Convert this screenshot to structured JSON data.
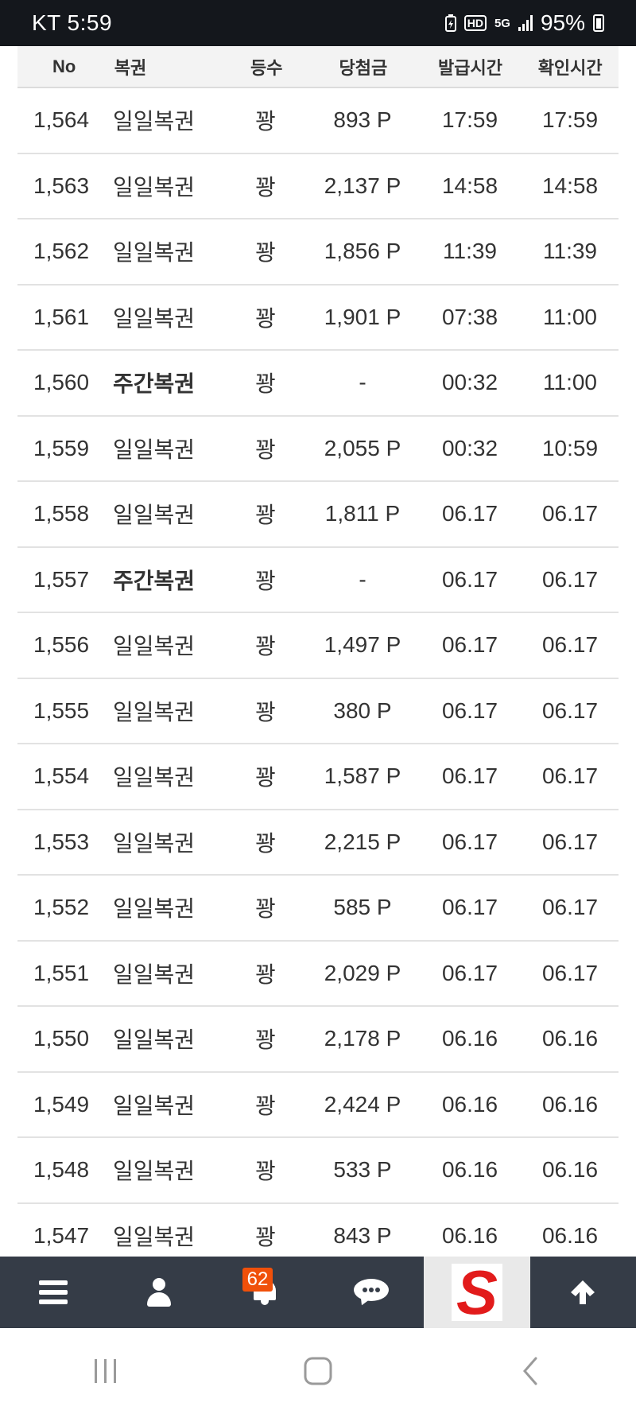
{
  "status_bar": {
    "carrier_time": "KT 5:59",
    "hd_label": "HD",
    "network_label": "5G",
    "battery": "95%"
  },
  "table": {
    "headers": {
      "no": "No",
      "type": "복권",
      "rank": "등수",
      "prize": "당첨금",
      "issued": "발급시간",
      "checked": "확인시간"
    },
    "rows": [
      {
        "no": "1,564",
        "type": "일일복권",
        "rank": "꽝",
        "prize": "893 P",
        "issued": "17:59",
        "checked": "17:59"
      },
      {
        "no": "1,563",
        "type": "일일복권",
        "rank": "꽝",
        "prize": "2,137 P",
        "issued": "14:58",
        "checked": "14:58"
      },
      {
        "no": "1,562",
        "type": "일일복권",
        "rank": "꽝",
        "prize": "1,856 P",
        "issued": "11:39",
        "checked": "11:39"
      },
      {
        "no": "1,561",
        "type": "일일복권",
        "rank": "꽝",
        "prize": "1,901 P",
        "issued": "07:38",
        "checked": "11:00"
      },
      {
        "no": "1,560",
        "type": "주간복권",
        "rank": "꽝",
        "prize": "-",
        "issued": "00:32",
        "checked": "11:00",
        "bold": true
      },
      {
        "no": "1,559",
        "type": "일일복권",
        "rank": "꽝",
        "prize": "2,055 P",
        "issued": "00:32",
        "checked": "10:59"
      },
      {
        "no": "1,558",
        "type": "일일복권",
        "rank": "꽝",
        "prize": "1,811 P",
        "issued": "06.17",
        "checked": "06.17"
      },
      {
        "no": "1,557",
        "type": "주간복권",
        "rank": "꽝",
        "prize": "-",
        "issued": "06.17",
        "checked": "06.17",
        "bold": true
      },
      {
        "no": "1,556",
        "type": "일일복권",
        "rank": "꽝",
        "prize": "1,497 P",
        "issued": "06.17",
        "checked": "06.17"
      },
      {
        "no": "1,555",
        "type": "일일복권",
        "rank": "꽝",
        "prize": "380 P",
        "issued": "06.17",
        "checked": "06.17"
      },
      {
        "no": "1,554",
        "type": "일일복권",
        "rank": "꽝",
        "prize": "1,587 P",
        "issued": "06.17",
        "checked": "06.17"
      },
      {
        "no": "1,553",
        "type": "일일복권",
        "rank": "꽝",
        "prize": "2,215 P",
        "issued": "06.17",
        "checked": "06.17"
      },
      {
        "no": "1,552",
        "type": "일일복권",
        "rank": "꽝",
        "prize": "585 P",
        "issued": "06.17",
        "checked": "06.17"
      },
      {
        "no": "1,551",
        "type": "일일복권",
        "rank": "꽝",
        "prize": "2,029 P",
        "issued": "06.17",
        "checked": "06.17"
      },
      {
        "no": "1,550",
        "type": "일일복권",
        "rank": "꽝",
        "prize": "2,178 P",
        "issued": "06.16",
        "checked": "06.16"
      },
      {
        "no": "1,549",
        "type": "일일복권",
        "rank": "꽝",
        "prize": "2,424 P",
        "issued": "06.16",
        "checked": "06.16"
      },
      {
        "no": "1,548",
        "type": "일일복권",
        "rank": "꽝",
        "prize": "533 P",
        "issued": "06.16",
        "checked": "06.16"
      },
      {
        "no": "1,547",
        "type": "일일복권",
        "rank": "꽝",
        "prize": "843 P",
        "issued": "06.16",
        "checked": "06.16"
      }
    ]
  },
  "bottom_nav": {
    "notification_count": "62",
    "logo_letter": "S",
    "icons": [
      "menu-icon",
      "user-icon",
      "bell-icon",
      "chat-icon",
      "site-logo",
      "arrow-up-icon"
    ]
  },
  "colors": {
    "status_bar_bg": "#14171c",
    "nav_bg": "#353c47",
    "badge_bg": "#f0500a",
    "logo_red": "#e21b1b"
  }
}
